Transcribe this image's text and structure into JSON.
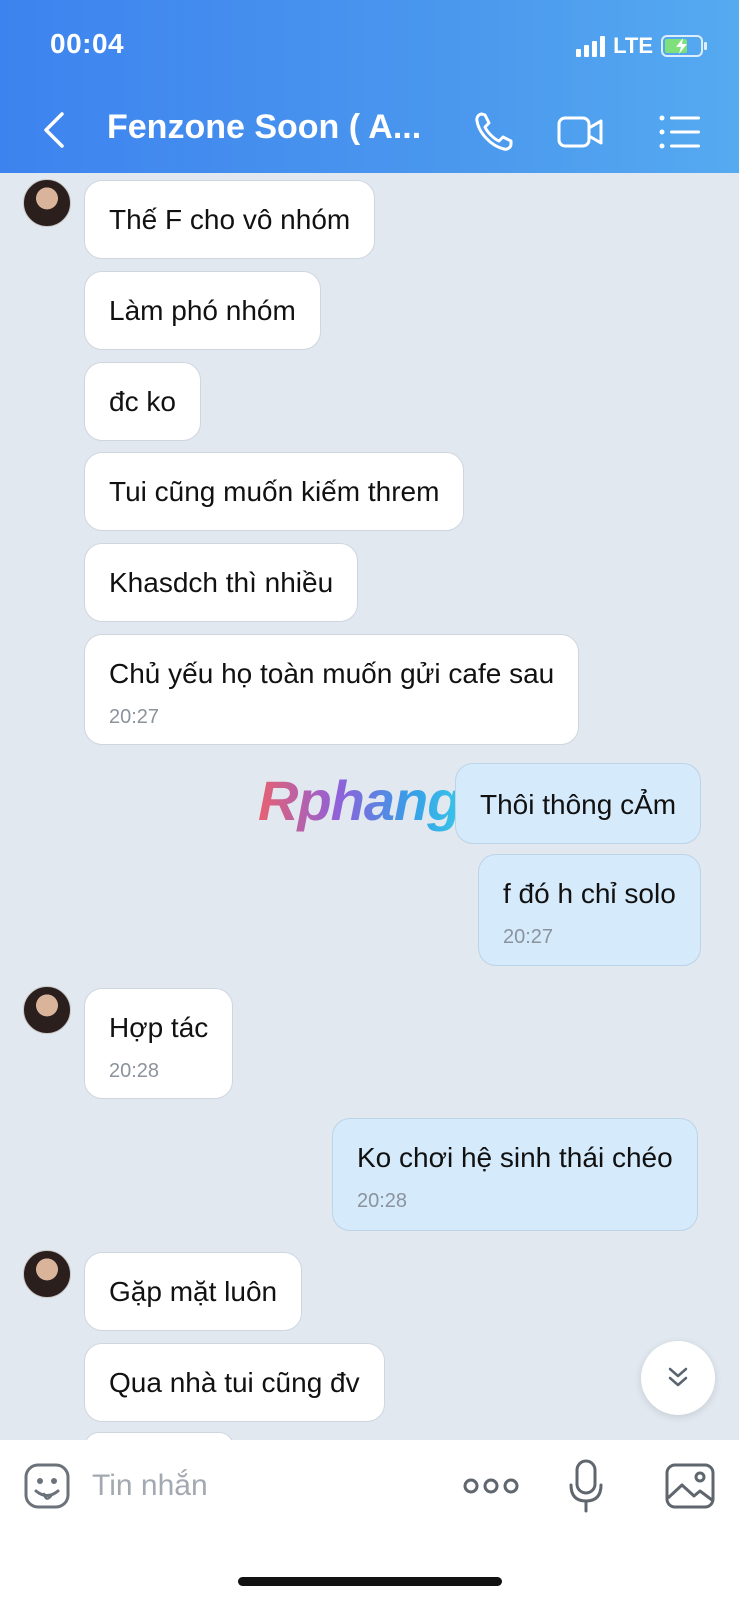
{
  "status_bar": {
    "time": "00:04",
    "network": "LTE"
  },
  "header": {
    "title": "Fenzone Soon ( A..."
  },
  "watermark": "Rphang",
  "messages": [
    {
      "direction": "in",
      "text": "Thế F cho vô nhóm"
    },
    {
      "direction": "in",
      "text": "Làm phó nhóm"
    },
    {
      "direction": "in",
      "text": "đc ko"
    },
    {
      "direction": "in",
      "text": "Tui cũng muốn kiếm threm"
    },
    {
      "direction": "in",
      "text": "Khasdch thì nhiều"
    },
    {
      "direction": "in",
      "text": "Chủ yếu họ toàn muốn gửi cafe sau",
      "time": "20:27"
    },
    {
      "direction": "out",
      "text": "Thôi thông cẢm"
    },
    {
      "direction": "out",
      "text": "f đó h chỉ solo",
      "time": "20:27"
    },
    {
      "direction": "in",
      "text": "Hợp tác",
      "time": "20:28"
    },
    {
      "direction": "out",
      "text": "Ko chơi hệ sinh thái chéo",
      "time": "20:28"
    },
    {
      "direction": "in",
      "text": "Gặp mặt luôn"
    },
    {
      "direction": "in",
      "text": "Qua nhà tui cũng đv"
    }
  ],
  "composer": {
    "placeholder": "Tin nhắn"
  },
  "colors": {
    "header_start": "#3d83ef",
    "header_end": "#55aaf0",
    "chat_bg": "#e2e8f0",
    "outgoing_bubble": "#d5eafb"
  }
}
